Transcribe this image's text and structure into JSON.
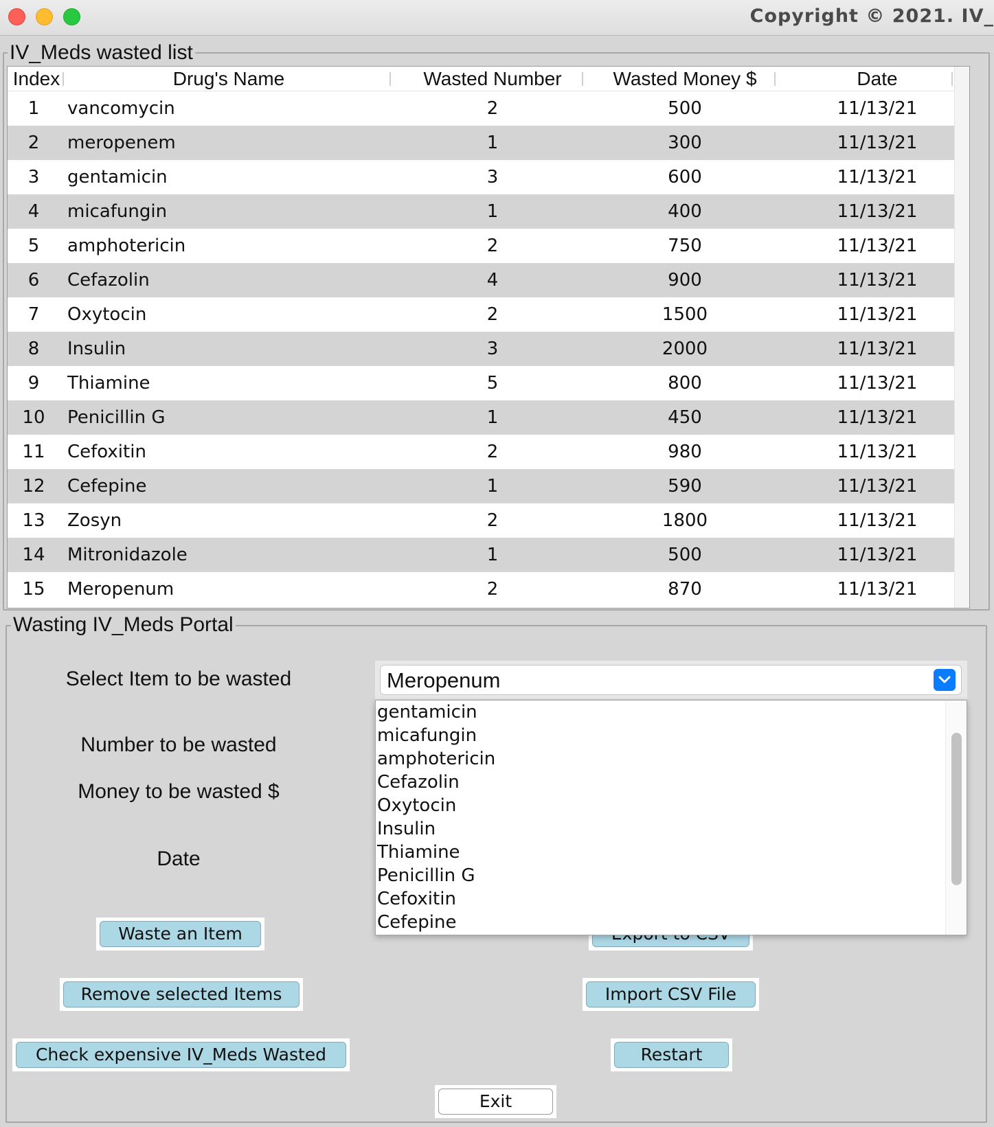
{
  "window": {
    "title": "Copyright © 2021. IV_"
  },
  "list_group": {
    "title": "IV_Meds wasted list",
    "columns": [
      "Index",
      "Drug's Name",
      "Wasted Number",
      "Wasted Money $",
      "Date"
    ],
    "rows": [
      [
        "1",
        "vancomycin",
        "2",
        "500",
        "11/13/21"
      ],
      [
        "2",
        "meropenem",
        "1",
        "300",
        "11/13/21"
      ],
      [
        "3",
        "gentamicin",
        "3",
        "600",
        "11/13/21"
      ],
      [
        "4",
        "micafungin",
        "1",
        "400",
        "11/13/21"
      ],
      [
        "5",
        "amphotericin",
        "2",
        "750",
        "11/13/21"
      ],
      [
        "6",
        "Cefazolin",
        "4",
        "900",
        "11/13/21"
      ],
      [
        "7",
        "Oxytocin",
        "2",
        "1500",
        "11/13/21"
      ],
      [
        "8",
        "Insulin",
        "3",
        "2000",
        "11/13/21"
      ],
      [
        "9",
        "Thiamine",
        "5",
        "800",
        "11/13/21"
      ],
      [
        "10",
        "Penicillin G",
        "1",
        "450",
        "11/13/21"
      ],
      [
        "11",
        "Cefoxitin",
        "2",
        "980",
        "11/13/21"
      ],
      [
        "12",
        "Cefepine",
        "1",
        "590",
        "11/13/21"
      ],
      [
        "13",
        "Zosyn",
        "2",
        "1800",
        "11/13/21"
      ],
      [
        "14",
        "Mitronidazole",
        "1",
        "500",
        "11/13/21"
      ],
      [
        "15",
        "Meropenum",
        "2",
        "870",
        "11/13/21"
      ]
    ]
  },
  "portal": {
    "title": "Wasting IV_Meds Portal",
    "select_label": "Select Item to be wasted",
    "number_label": "Number to be wasted",
    "money_label": "Money to be wasted $",
    "date_label": "Date",
    "combo": {
      "value": "Meropenum",
      "options_visible": [
        "gentamicin",
        "micafungin",
        "amphotericin",
        "Cefazolin",
        "Oxytocin",
        "Insulin",
        "Thiamine",
        "Penicillin G",
        "Cefoxitin",
        "Cefepine"
      ]
    },
    "buttons": {
      "waste": "Waste an Item",
      "remove": "Remove selected Items",
      "check": "Check expensive IV_Meds Wasted",
      "export": "Export to CSV",
      "import": "Import CSV File",
      "restart": "Restart",
      "exit": "Exit"
    }
  },
  "colors": {
    "button_fill": "#acd8e6",
    "row_alt": "#d4d4d4",
    "combo_accent": "#0a7cff"
  },
  "icons": [
    "close-window-icon",
    "minimize-window-icon",
    "zoom-window-icon",
    "chevron-down-icon"
  ]
}
